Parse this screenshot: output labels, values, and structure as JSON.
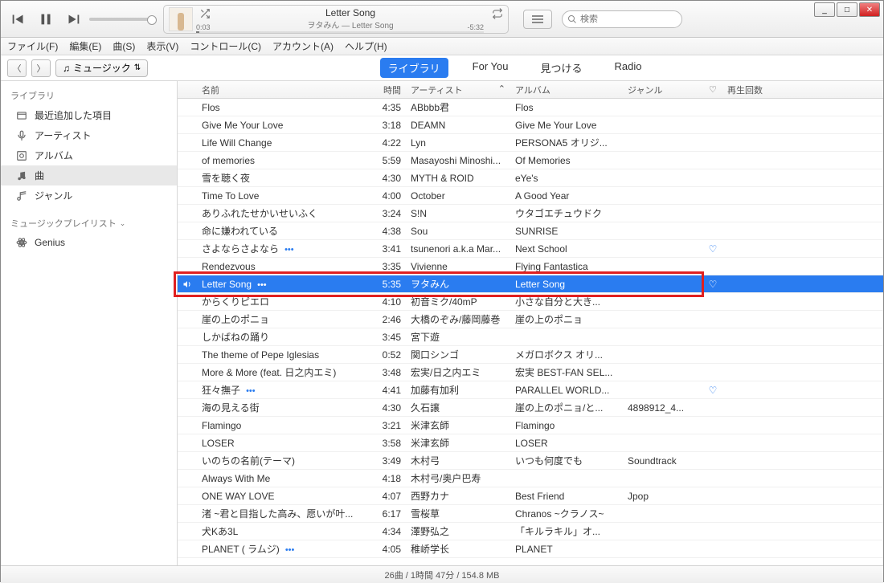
{
  "window": {
    "minimize": "_",
    "maximize": "□",
    "close": "✕"
  },
  "player": {
    "title": "Letter Song",
    "subtitle": "ヲタみん — Letter Song",
    "elapsed": "0:03",
    "remaining": "-5:32"
  },
  "search": {
    "placeholder": "検索"
  },
  "menus": [
    "ファイル(F)",
    "編集(E)",
    "曲(S)",
    "表示(V)",
    "コントロール(C)",
    "アカウント(A)",
    "ヘルプ(H)"
  ],
  "music_selector": "ミュージック",
  "tabs": [
    {
      "label": "ライブラリ",
      "active": true
    },
    {
      "label": "For You",
      "active": false
    },
    {
      "label": "見つける",
      "active": false
    },
    {
      "label": "Radio",
      "active": false
    }
  ],
  "sidebar": {
    "library_head": "ライブラリ",
    "library_items": [
      {
        "icon": "recent",
        "label": "最近追加した項目"
      },
      {
        "icon": "mic",
        "label": "アーティスト"
      },
      {
        "icon": "album",
        "label": "アルバム"
      },
      {
        "icon": "note",
        "label": "曲",
        "selected": true
      },
      {
        "icon": "genre",
        "label": "ジャンル"
      }
    ],
    "playlist_head": "ミュージックプレイリスト",
    "playlist_items": [
      {
        "icon": "genius",
        "label": "Genius"
      }
    ]
  },
  "columns": {
    "name": "名前",
    "time": "時間",
    "artist": "アーティスト",
    "album": "アルバム",
    "genre": "ジャンル",
    "love": "♡",
    "plays": "再生回数"
  },
  "sort_indicator": "⌃",
  "tracks": [
    {
      "name": "Flos",
      "time": "4:35",
      "artist": "ABbbb君",
      "album": "Flos"
    },
    {
      "name": "Give Me Your Love",
      "time": "3:18",
      "artist": "DEAMN",
      "album": "Give Me Your Love"
    },
    {
      "name": "Life Will Change",
      "time": "4:22",
      "artist": "Lyn",
      "album": "PERSONA5 オリジ..."
    },
    {
      "name": "of memories",
      "time": "5:59",
      "artist": "Masayoshi Minoshi...",
      "album": "Of Memories"
    },
    {
      "name": "雪を聴く夜",
      "time": "4:30",
      "artist": "MYTH & ROID",
      "album": "eYe's"
    },
    {
      "name": "Time To Love",
      "time": "4:00",
      "artist": "October",
      "album": "A Good Year"
    },
    {
      "name": "ありふれたせかいせいふく",
      "time": "3:24",
      "artist": "S!N",
      "album": "ウタゴエチュウドク"
    },
    {
      "name": "命に嫌われている",
      "time": "4:38",
      "artist": "Sou",
      "album": "SUNRISE"
    },
    {
      "name": "さよならさよなら",
      "dots": true,
      "time": "3:41",
      "artist": "tsunenori a.k.a Mar...",
      "album": "Next School",
      "love": true
    },
    {
      "name": "Rendezvous",
      "time": "3:35",
      "artist": "Vivienne",
      "album": "Flying Fantastica"
    },
    {
      "name": "Letter Song",
      "dots": true,
      "time": "5:35",
      "artist": "ヲタみん",
      "album": "Letter Song",
      "love": true,
      "playing": true
    },
    {
      "name": "からくりピエロ",
      "time": "4:10",
      "artist": "初音ミク/40mP",
      "album": "小さな自分と大き..."
    },
    {
      "name": "崖の上のポニョ",
      "time": "2:46",
      "artist": "大橋のぞみ/藤岡藤巻",
      "album": "崖の上のポニョ"
    },
    {
      "name": "しかばねの踊り",
      "time": "3:45",
      "artist": "宮下遊"
    },
    {
      "name": "The theme of Pepe Iglesias",
      "time": "0:52",
      "artist": "関口シンゴ",
      "album": "メガロボクス オリ..."
    },
    {
      "name": "More & More (feat. 日之内エミ)",
      "time": "3:48",
      "artist": "宏実/日之内エミ",
      "album": "宏実 BEST-FAN SEL..."
    },
    {
      "name": "狂々撫子",
      "dots": true,
      "time": "4:41",
      "artist": "加藤有加利",
      "album": "PARALLEL WORLD...",
      "love": true
    },
    {
      "name": "海の見える街",
      "time": "4:30",
      "artist": "久石譲",
      "album": "崖の上のポニョ/と...",
      "genre": "4898912_4..."
    },
    {
      "name": "Flamingo",
      "time": "3:21",
      "artist": "米津玄師",
      "album": "Flamingo"
    },
    {
      "name": "LOSER",
      "time": "3:58",
      "artist": "米津玄師",
      "album": "LOSER"
    },
    {
      "name": "いのちの名前(テーマ)",
      "time": "3:49",
      "artist": "木村弓",
      "album": "いつも何度でも",
      "genre": "Soundtrack"
    },
    {
      "name": "Always With Me",
      "time": "4:18",
      "artist": "木村弓/奥户巴寿"
    },
    {
      "name": "ONE WAY LOVE",
      "time": "4:07",
      "artist": "西野カナ",
      "album": "Best Friend",
      "genre": "Jpop"
    },
    {
      "name": "渚 ~君と目指した高み、愿いが叶...",
      "time": "6:17",
      "artist": "雪桜草",
      "album": "Chranos ~クラノス~"
    },
    {
      "name": "犬Kあ3L",
      "time": "4:34",
      "artist": "澤野弘之",
      "album": "「キルラキル」オ..."
    },
    {
      "name": "PLANET (           ラムジ)",
      "dots": true,
      "time": "4:05",
      "artist": "稚峤学长",
      "album": "PLANET"
    }
  ],
  "footer": "26曲 / 1時間 47分 / 154.8 MB"
}
